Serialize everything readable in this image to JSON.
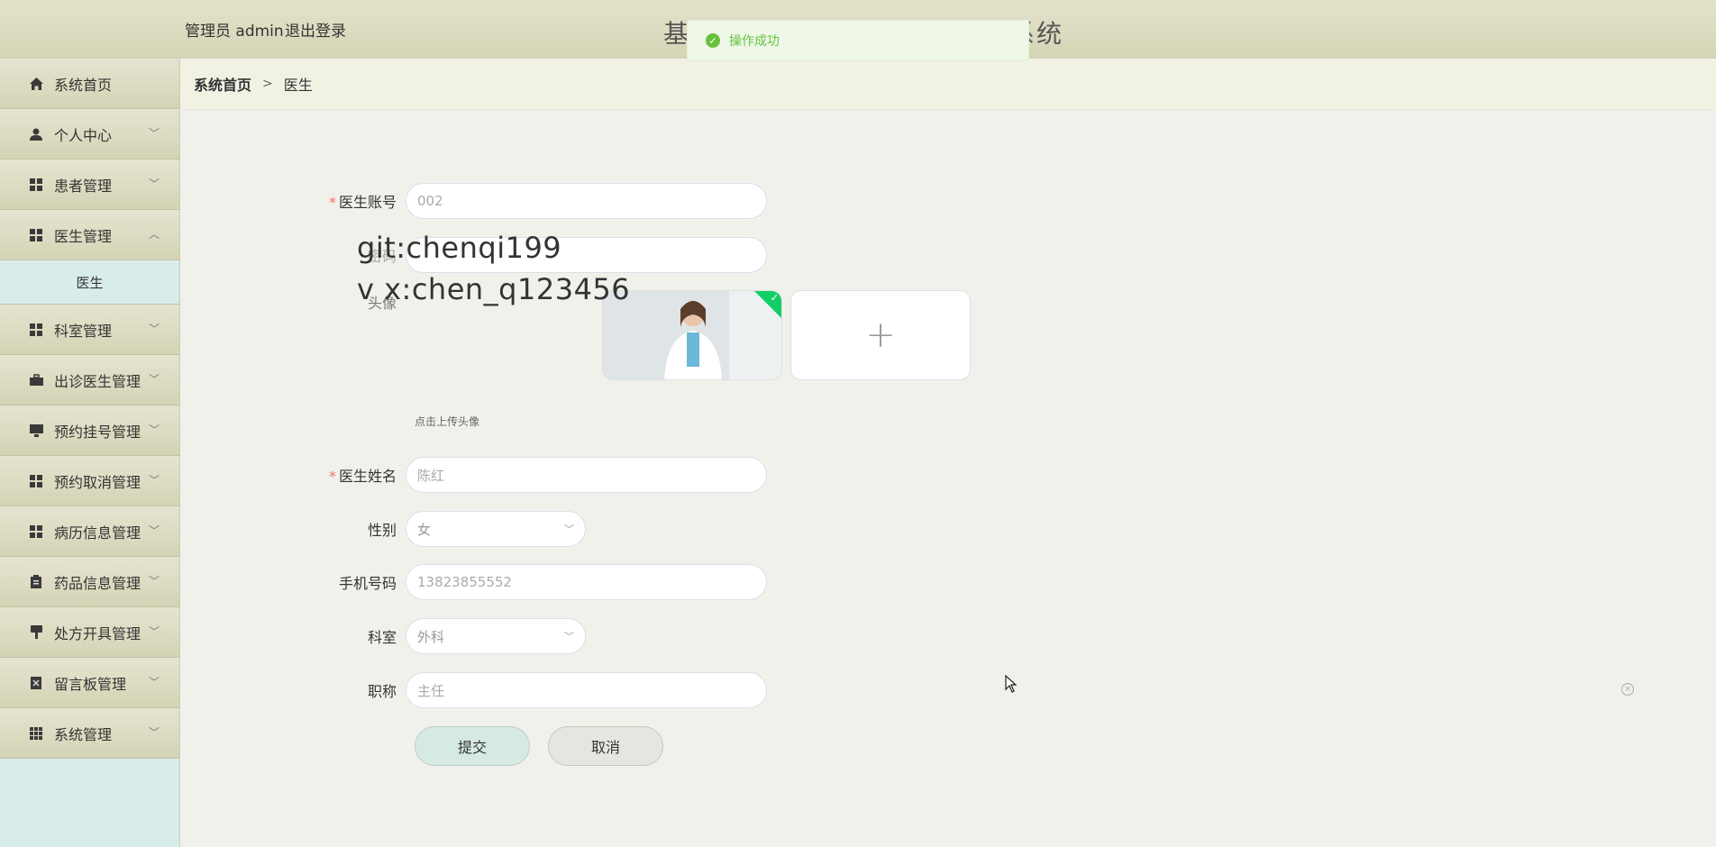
{
  "header": {
    "admin_label": "管理员 admin",
    "logout_label": "退出登录",
    "title_left": "基",
    "title_right": "系统"
  },
  "toast": {
    "message": "操作成功",
    "icon": "success-check-icon"
  },
  "sidebar": {
    "items": [
      {
        "label": "系统首页",
        "icon": "home-icon"
      },
      {
        "label": "个人中心",
        "icon": "user-icon"
      },
      {
        "label": "患者管理",
        "icon": "grid-icon"
      },
      {
        "label": "医生管理",
        "icon": "grid-icon"
      },
      {
        "label": "科室管理",
        "icon": "grid-icon"
      },
      {
        "label": "出诊医生管理",
        "icon": "briefcase-icon"
      },
      {
        "label": "预约挂号管理",
        "icon": "monitor-icon"
      },
      {
        "label": "预约取消管理",
        "icon": "grid-icon"
      },
      {
        "label": "病历信息管理",
        "icon": "grid-icon"
      },
      {
        "label": "药品信息管理",
        "icon": "clipboard-icon"
      },
      {
        "label": "处方开具管理",
        "icon": "stamp-icon"
      },
      {
        "label": "留言板管理",
        "icon": "note-icon"
      },
      {
        "label": "系统管理",
        "icon": "apps-icon"
      }
    ],
    "sub_items": {
      "doctor": "医生"
    }
  },
  "breadcrumb": {
    "home": "系统首页",
    "separator": ">",
    "current": "医生"
  },
  "form": {
    "account_label": "医生账号",
    "account_placeholder": "002",
    "password_label": "密码",
    "avatar_label": "头像",
    "avatar_tip": "点击上传头像",
    "name_label": "医生姓名",
    "name_placeholder": "陈红",
    "gender_label": "性别",
    "gender_value": "女",
    "phone_label": "手机号码",
    "phone_placeholder": "13823855552",
    "dept_label": "科室",
    "dept_value": "外科",
    "title_label": "职称",
    "title_placeholder": "主任",
    "submit_label": "提交",
    "cancel_label": "取消"
  },
  "watermark": {
    "line1": "git:chenqi199",
    "line2": "v x:chen_q123456"
  },
  "colors": {
    "required": "#f56c6c",
    "success": "#67c23a",
    "sidebar_active_bg": "#d9ecec",
    "submit_bg": "#d6e9e2"
  }
}
